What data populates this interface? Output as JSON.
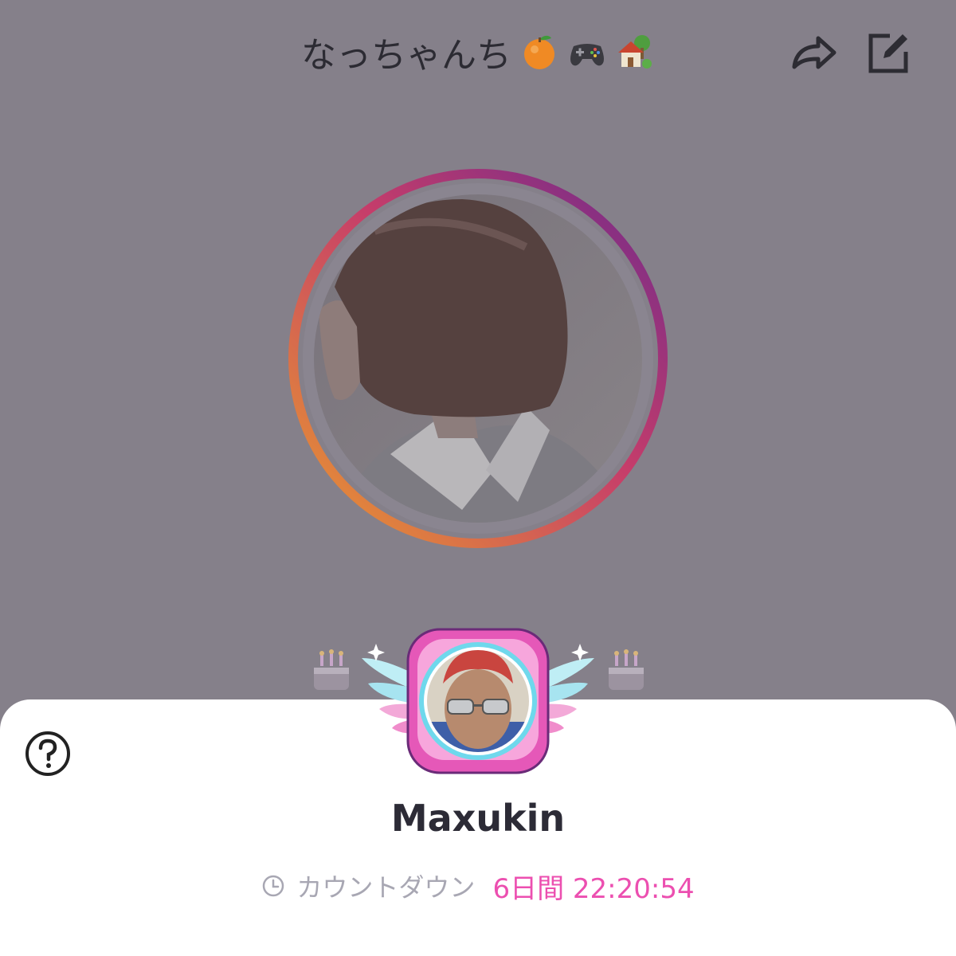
{
  "header": {
    "title": "なっちゃんち",
    "title_emojis": [
      "orange-emoji",
      "game-controller-emoji",
      "house-emoji"
    ],
    "share_icon": "share-arrow-icon",
    "edit_icon": "edit-compose-icon"
  },
  "profile": {
    "avatar": "profile-photo",
    "ring_colors": [
      "#8b2fa3",
      "#e2407a",
      "#f2993a"
    ],
    "birthday_icon": "birthday-cake-icon"
  },
  "sheet": {
    "help_icon": "question-circle-icon",
    "badge": "winged-frame-badge",
    "user_name": "Maxukin",
    "countdown": {
      "label": "カウントダウン",
      "value": "6日間 22:20:54",
      "icon": "clock-icon"
    }
  },
  "colors": {
    "backdrop": "#85808a",
    "accent_pink": "#ec4fb0",
    "muted_text": "#a8a7b3",
    "badge_cyan": "#6fd8ec"
  }
}
